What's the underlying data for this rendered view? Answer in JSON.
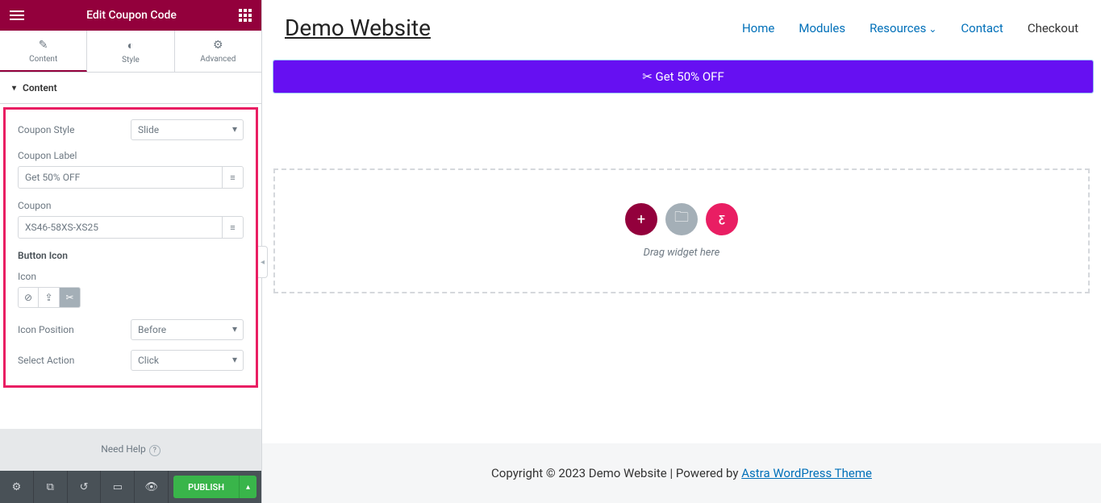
{
  "header": {
    "title": "Edit Coupon Code"
  },
  "tabs": {
    "content": "Content",
    "style": "Style",
    "advanced": "Advanced"
  },
  "section": {
    "title": "Content"
  },
  "controls": {
    "coupon_style_label": "Coupon Style",
    "coupon_style_value": "Slide",
    "coupon_label_label": "Coupon Label",
    "coupon_label_value": "Get 50% OFF",
    "coupon_label2": "Coupon",
    "coupon_value": "XS46-58XS-XS25",
    "button_icon_label": "Button Icon",
    "icon_label": "Icon",
    "icon_position_label": "Icon Position",
    "icon_position_value": "Before",
    "select_action_label": "Select Action",
    "select_action_value": "Click"
  },
  "need_help": "Need Help",
  "publish": "PUBLISH",
  "site": {
    "title": "Demo Website",
    "nav": {
      "home": "Home",
      "modules": "Modules",
      "resources": "Resources",
      "contact": "Contact",
      "checkout": "Checkout"
    },
    "coupon_text": "Get 50% OFF",
    "drop_text": "Drag widget here",
    "footer_text": "Copyright © 2023 Demo Website | Powered by ",
    "footer_link": "Astra WordPress Theme"
  }
}
